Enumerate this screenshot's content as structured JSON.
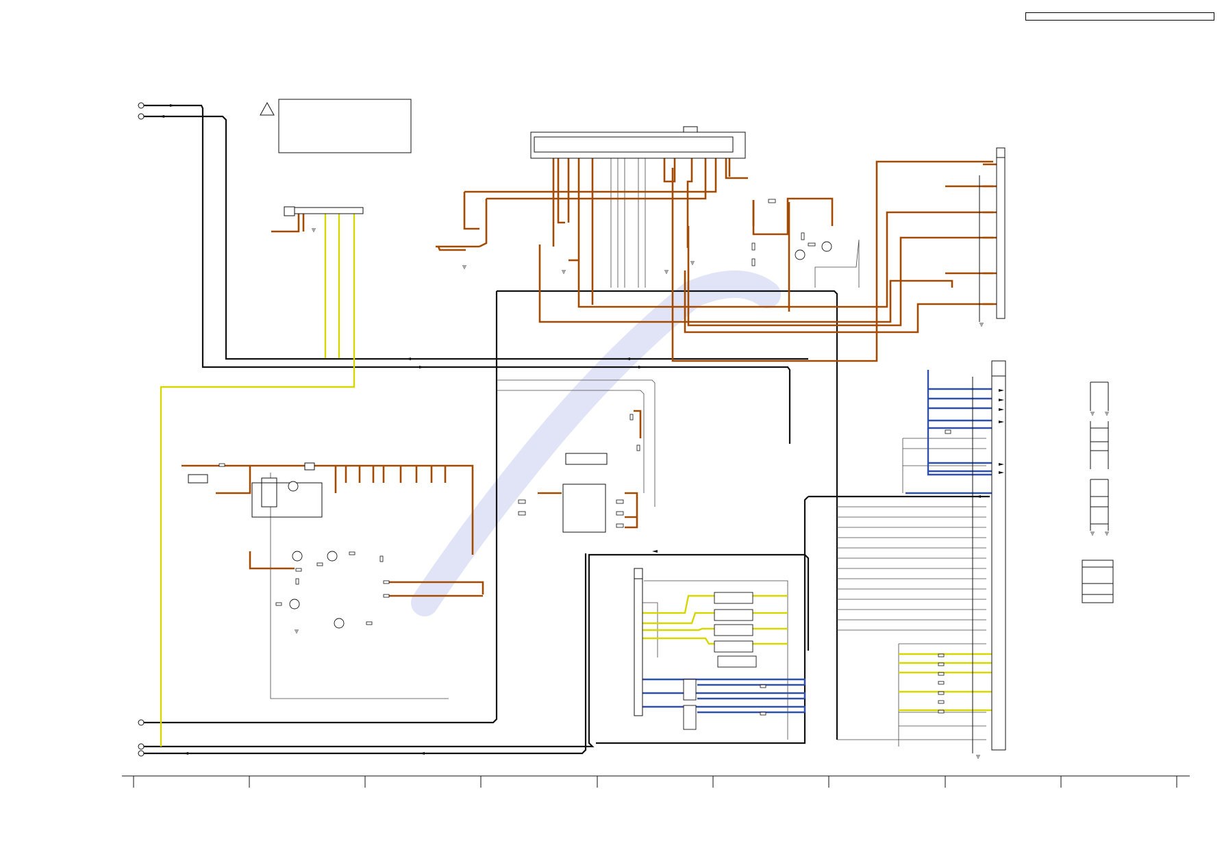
{
  "header": {
    "reference_box_text": ""
  },
  "colors": {
    "power_trace": "#a14a00",
    "data_trace": "#2f4fa8",
    "audio_trace": "#d6d600",
    "black_trace": "#111111",
    "thin_trace": "#444444",
    "watermark": "#c9cdee"
  },
  "warning": {
    "symbol": "!",
    "note_text": ""
  },
  "zone_labels": [
    "",
    "",
    "",
    "",
    "",
    "",
    "",
    "",
    ""
  ]
}
